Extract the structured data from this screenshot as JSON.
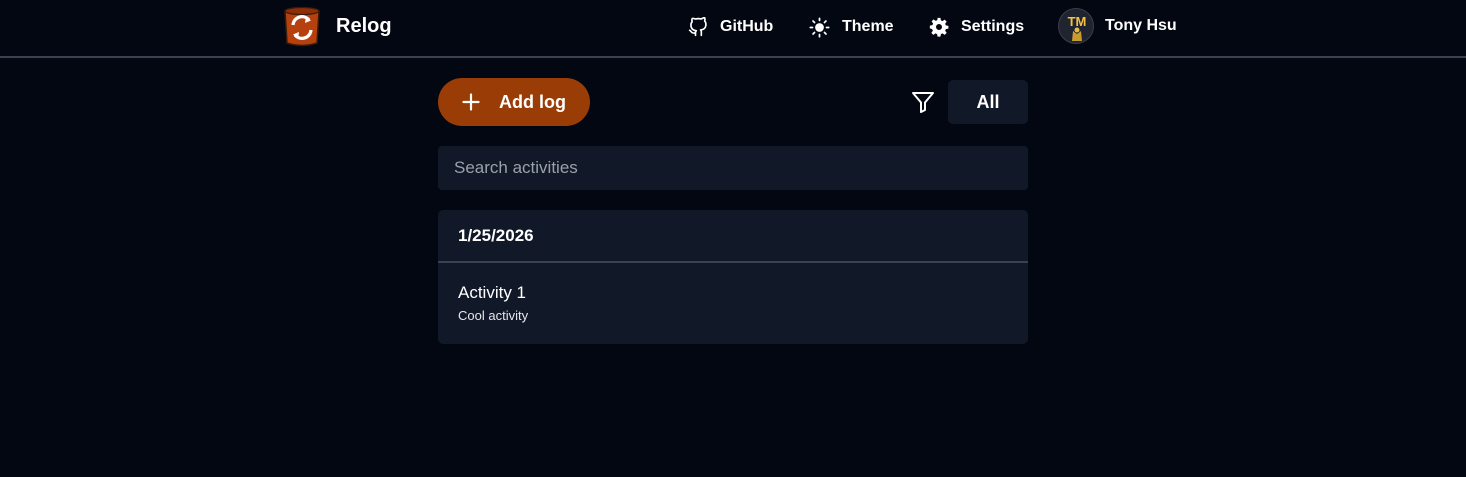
{
  "header": {
    "brand_name": "Relog",
    "nav": {
      "github_label": "GitHub",
      "theme_label": "Theme",
      "settings_label": "Settings"
    },
    "user": {
      "name": "Tony Hsu",
      "avatar_initials": "TM"
    }
  },
  "toolbar": {
    "add_label": "Add log",
    "filter_value": "All"
  },
  "search": {
    "placeholder": "Search activities",
    "value": ""
  },
  "logs": [
    {
      "date": "1/25/2026",
      "entries": [
        {
          "title": "Activity 1",
          "description": "Cool activity"
        }
      ]
    }
  ],
  "colors": {
    "background": "#030712",
    "surface": "#111827",
    "accent": "#9a3c05",
    "divider": "#3a4150"
  }
}
